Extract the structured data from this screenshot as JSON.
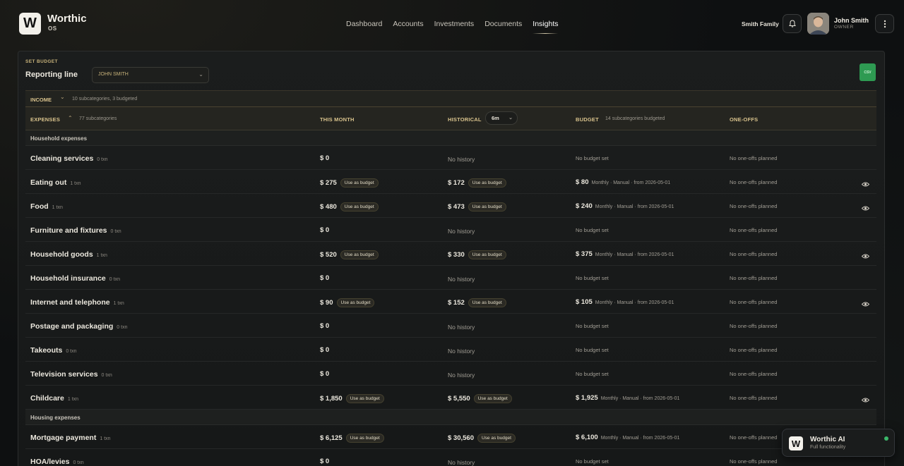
{
  "brand": {
    "name": "Worthic",
    "sub": "OS",
    "logo_letter": "W"
  },
  "nav": [
    "Dashboard",
    "Accounts",
    "Investments",
    "Documents",
    "Insights"
  ],
  "nav_active": "Insights",
  "header": {
    "family": "Smith Family",
    "user_name": "John Smith",
    "user_role": "OWNER"
  },
  "panel": {
    "eyebrow": "SET BUDGET",
    "reporting_label": "Reporting line",
    "reporting_value": "JOHN SMITH",
    "csv_label": "CSV"
  },
  "income": {
    "label": "INCOME",
    "summary": "10 subcategories, 3 budgeted"
  },
  "columns": {
    "expenses": "EXPENSES",
    "expenses_sub": "77 subcategories",
    "this_month": "THIS MONTH",
    "historical": "HISTORICAL",
    "historical_period": "6m",
    "budget": "BUDGET",
    "budget_sub": "14 subcategories budgeted",
    "one_offs": "ONE-OFFS"
  },
  "labels": {
    "use_as_budget": "Use as budget",
    "no_history": "No history",
    "no_budget": "No budget set",
    "no_oneoffs": "No one-offs planned"
  },
  "rows": [
    {
      "type": "section",
      "label": "Household expenses"
    },
    {
      "name": "Cleaning services",
      "txn": "0 txn",
      "month": "$ 0",
      "hist": null,
      "budget": null,
      "meta": null
    },
    {
      "name": "Eating out",
      "txn": "1 txn",
      "month": "$ 275",
      "hist": "$ 172",
      "budget": "$ 80",
      "meta": "Monthly · Manual · from 2026-05-01"
    },
    {
      "name": "Food",
      "txn": "1 txn",
      "month": "$ 480",
      "hist": "$ 473",
      "budget": "$ 240",
      "meta": "Monthly · Manual · from 2026-05-01"
    },
    {
      "name": "Furniture and fixtures",
      "txn": "0 txn",
      "month": "$ 0",
      "hist": null,
      "budget": null,
      "meta": null
    },
    {
      "name": "Household goods",
      "txn": "1 txn",
      "month": "$ 520",
      "hist": "$ 330",
      "budget": "$ 375",
      "meta": "Monthly · Manual · from 2026-05-01"
    },
    {
      "name": "Household insurance",
      "txn": "0 txn",
      "month": "$ 0",
      "hist": null,
      "budget": null,
      "meta": null
    },
    {
      "name": "Internet and telephone",
      "txn": "1 txn",
      "month": "$ 90",
      "hist": "$ 152",
      "budget": "$ 105",
      "meta": "Monthly · Manual · from 2026-05-01"
    },
    {
      "name": "Postage and packaging",
      "txn": "0 txn",
      "month": "$ 0",
      "hist": null,
      "budget": null,
      "meta": null
    },
    {
      "name": "Takeouts",
      "txn": "0 txn",
      "month": "$ 0",
      "hist": null,
      "budget": null,
      "meta": null
    },
    {
      "name": "Television services",
      "txn": "0 txn",
      "month": "$ 0",
      "hist": null,
      "budget": null,
      "meta": null
    },
    {
      "name": "Childcare",
      "txn": "1 txn",
      "month": "$ 1,850",
      "hist": "$ 5,550",
      "budget": "$ 1,925",
      "meta": "Monthly · Manual · from 2026-05-01"
    },
    {
      "type": "section",
      "label": "Housing expenses"
    },
    {
      "name": "Mortgage payment",
      "txn": "1 txn",
      "month": "$ 6,125",
      "hist": "$ 30,560",
      "budget": "$ 6,100",
      "meta": "Monthly · Manual · from 2026-05-01"
    },
    {
      "name": "HOA/levies",
      "txn": "0 txn",
      "month": "$ 0",
      "hist": null,
      "budget": null,
      "meta": null
    }
  ],
  "ai_widget": {
    "title": "Worthic AI",
    "subtitle": "Full functionality",
    "logo_letter": "W",
    "status_color": "#3bb86a"
  }
}
